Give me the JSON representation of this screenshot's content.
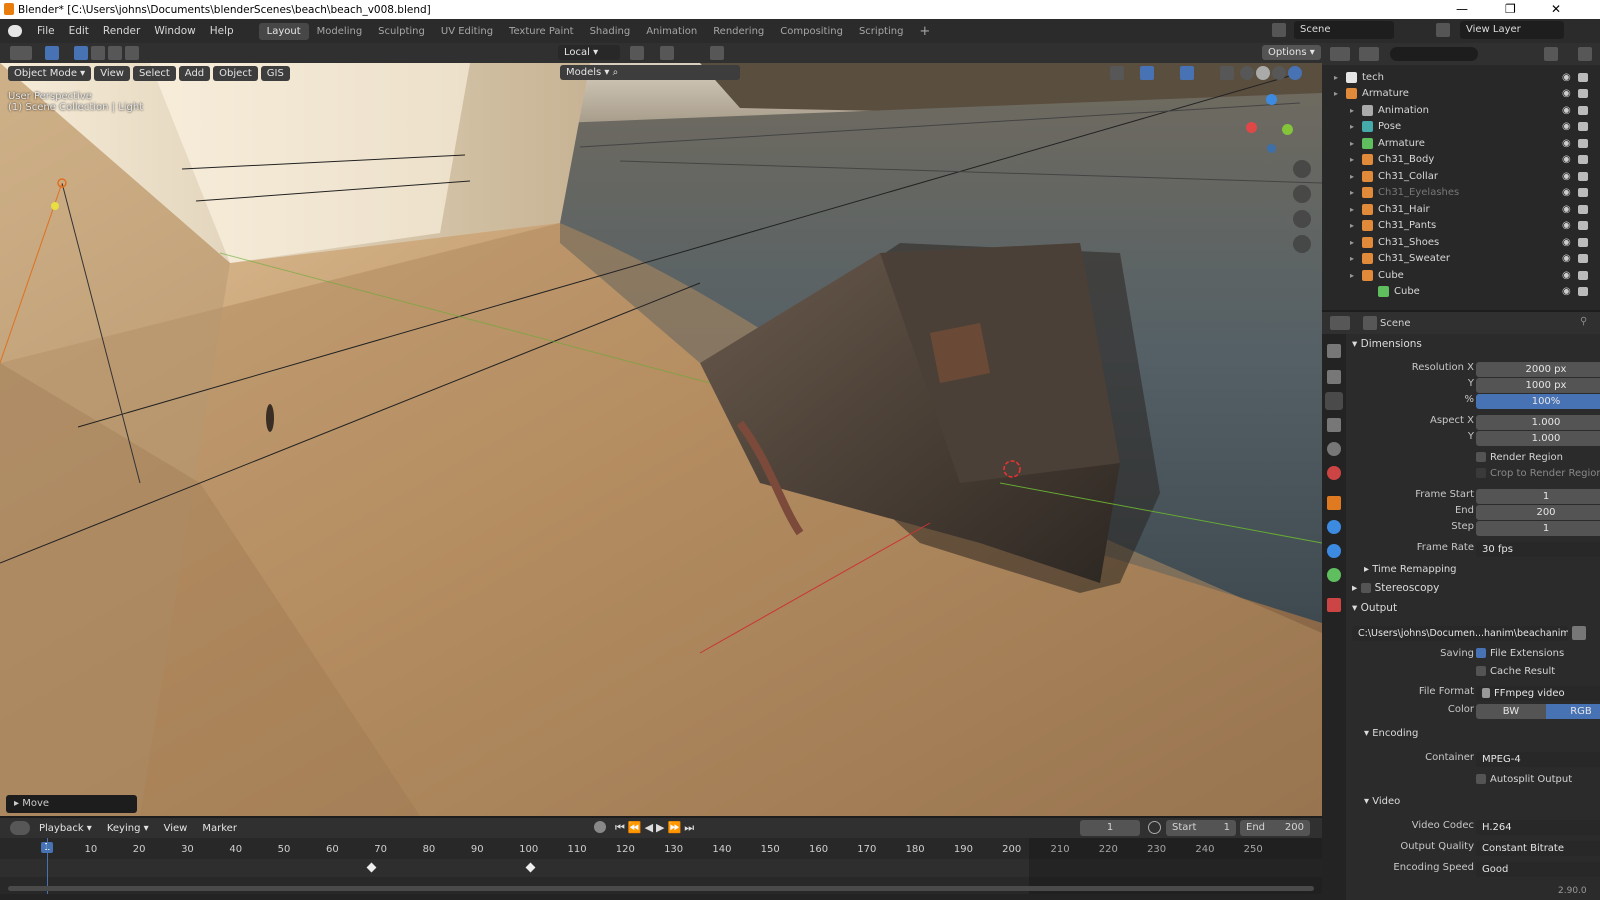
{
  "window": {
    "title": "Blender* [C:\\Users\\johns\\Documents\\blenderScenes\\beach\\beach_v008.blend]"
  },
  "menu": [
    "File",
    "Edit",
    "Render",
    "Window",
    "Help"
  ],
  "workspaces": [
    "Layout",
    "Modeling",
    "Sculpting",
    "UV Editing",
    "Texture Paint",
    "Shading",
    "Animation",
    "Rendering",
    "Compositing",
    "Scripting"
  ],
  "top_right": {
    "scene": "Scene",
    "view_layer": "View Layer"
  },
  "viewport_header": {
    "transform_orientation": "Local",
    "options": "Options",
    "mode": "Object Mode",
    "menus": [
      "View",
      "Select",
      "Add",
      "Object",
      "GIS"
    ],
    "collection": "Models"
  },
  "viewport_overlay": {
    "line1": "User Perspective",
    "line2": "(1) Scene Collection | Light"
  },
  "operator_panel": {
    "label": "Move"
  },
  "outliner": {
    "rows": [
      {
        "name": "tech",
        "indent": 1,
        "icon": "collection"
      },
      {
        "name": "Armature",
        "indent": 1,
        "icon": "armature"
      },
      {
        "name": "Animation",
        "indent": 2,
        "icon": "action"
      },
      {
        "name": "Pose",
        "indent": 2,
        "icon": "pose"
      },
      {
        "name": "Armature",
        "indent": 2,
        "icon": "armature-data"
      },
      {
        "name": "Ch31_Body",
        "indent": 2,
        "icon": "mesh"
      },
      {
        "name": "Ch31_Collar",
        "indent": 2,
        "icon": "mesh"
      },
      {
        "name": "Ch31_Eyelashes",
        "indent": 2,
        "icon": "mesh",
        "dim": true
      },
      {
        "name": "Ch31_Hair",
        "indent": 2,
        "icon": "mesh"
      },
      {
        "name": "Ch31_Pants",
        "indent": 2,
        "icon": "mesh"
      },
      {
        "name": "Ch31_Shoes",
        "indent": 2,
        "icon": "mesh"
      },
      {
        "name": "Ch31_Sweater",
        "indent": 2,
        "icon": "mesh"
      },
      {
        "name": "Cube",
        "indent": 2,
        "icon": "mesh"
      },
      {
        "name": "Cube",
        "indent": 3,
        "icon": "mesh-data"
      }
    ]
  },
  "properties": {
    "breadcrumb": "Scene",
    "dimensions": {
      "title": "Dimensions",
      "resolution_x_label": "Resolution X",
      "resolution_x": "2000 px",
      "y_label": "Y",
      "resolution_y": "1000 px",
      "pct_label": "%",
      "resolution_pct": "100%",
      "aspect_x_label": "Aspect X",
      "aspect_x": "1.000",
      "aspect_y": "1.000",
      "render_region": "Render Region",
      "crop_region": "Crop to Render Region",
      "frame_start_label": "Frame Start",
      "frame_start": "1",
      "end_label": "End",
      "frame_end": "200",
      "step_label": "Step",
      "frame_step": "1",
      "frame_rate_label": "Frame Rate",
      "frame_rate": "30 fps",
      "time_remapping": "Time Remapping"
    },
    "stereoscopy": "Stereoscopy",
    "output": {
      "title": "Output",
      "path": "C:\\Users\\johns\\Documen...hanim\\beachanim_v002_",
      "saving_label": "Saving",
      "file_extensions": "File Extensions",
      "cache_result": "Cache Result",
      "file_format_label": "File Format",
      "file_format": "FFmpeg video",
      "color_label": "Color",
      "color_bw": "BW",
      "color_rgb": "RGB"
    },
    "encoding": {
      "title": "Encoding",
      "container_label": "Container",
      "container": "MPEG-4",
      "autosplit": "Autosplit Output"
    },
    "video": {
      "title": "Video",
      "codec_label": "Video Codec",
      "codec": "H.264",
      "quality_label": "Output Quality",
      "quality": "Constant Bitrate",
      "speed_label": "Encoding Speed",
      "speed": "Good"
    }
  },
  "timeline": {
    "menus": [
      "Playback",
      "Keying",
      "View",
      "Marker"
    ],
    "current_frame": "1",
    "start_label": "Start",
    "start": "1",
    "end_label": "End",
    "end": "200",
    "ticks": [
      "1",
      "10",
      "20",
      "30",
      "40",
      "50",
      "60",
      "70",
      "80",
      "90",
      "100",
      "110",
      "120",
      "130",
      "140",
      "150",
      "160",
      "170",
      "180",
      "190",
      "200",
      "210",
      "220",
      "230",
      "240",
      "250"
    ],
    "keyframes": [
      68,
      101
    ]
  },
  "status": {
    "version": "2.90.0"
  },
  "colors": {
    "accent": "#4772b3",
    "header": "#303030",
    "panel": "#2b2b2b"
  }
}
